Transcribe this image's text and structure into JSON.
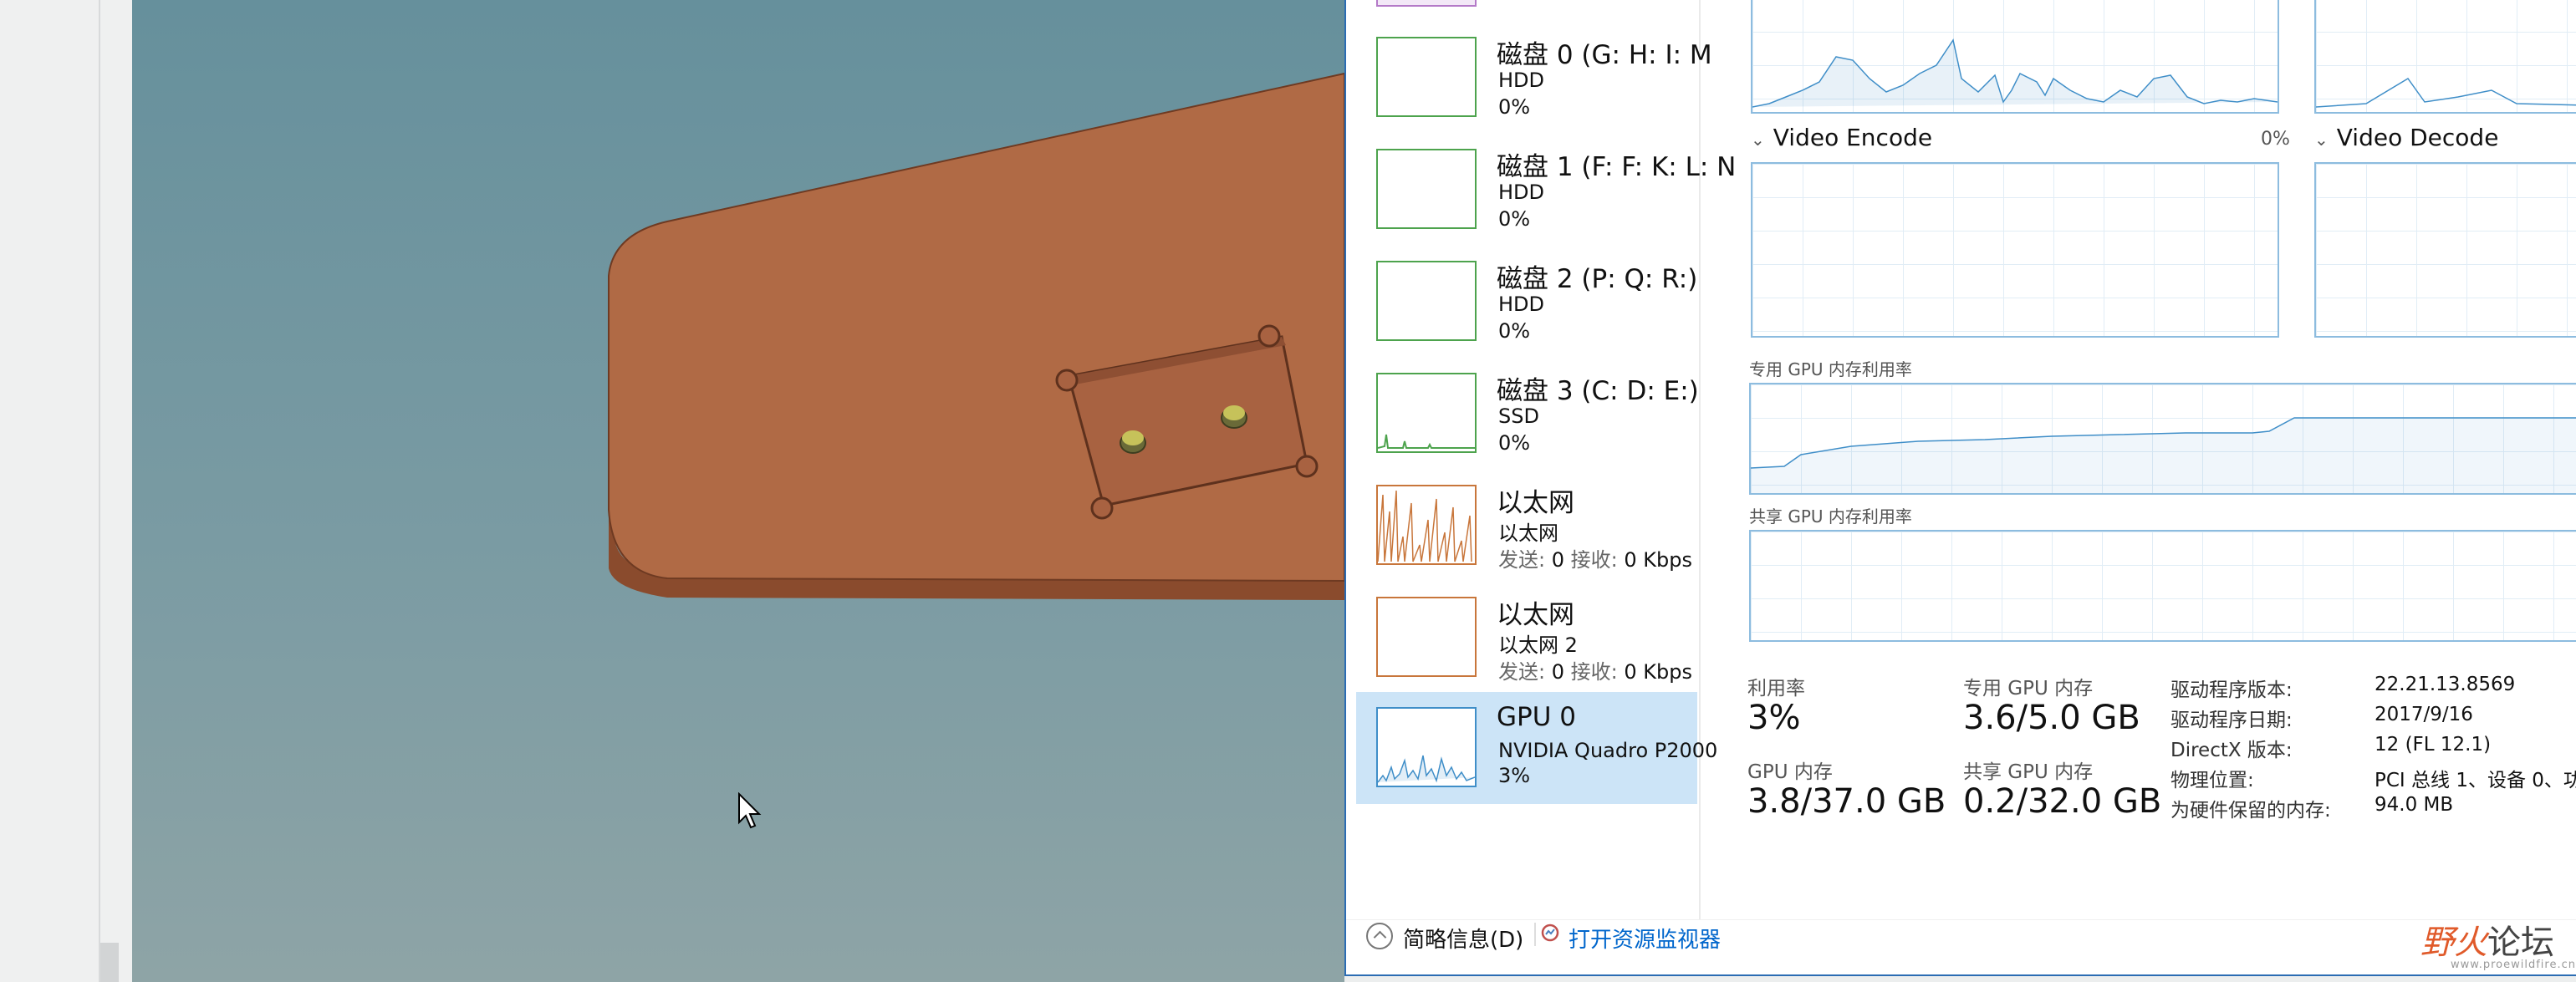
{
  "resources": [
    {
      "title": "磁盘 0 (G: H: I: M",
      "sub1": "HDD",
      "sub2": "0%",
      "color": "#4da34d"
    },
    {
      "title": "磁盘 1 (F: F: K: L: N",
      "sub1": "HDD",
      "sub2": "0%",
      "color": "#4da34d"
    },
    {
      "title": "磁盘 2 (P: Q: R:)",
      "sub1": "HDD",
      "sub2": "0%",
      "color": "#4da34d"
    },
    {
      "title": "磁盘 3 (C: D: E:)",
      "sub1": "SSD",
      "sub2": "0%",
      "color": "#4da34d"
    },
    {
      "title": "以太网",
      "sub1": "以太网",
      "send_label": "发送:",
      "send_value": "0",
      "recv_label": "接收:",
      "recv_value": "0 Kbps",
      "color": "#c8763b"
    },
    {
      "title": "以太网",
      "sub1": "以太网 2",
      "send_label": "发送:",
      "send_value": "0",
      "recv_label": "接收:",
      "recv_value": "0 Kbps",
      "color": "#c8763b"
    },
    {
      "title": "GPU 0",
      "sub1": "NVIDIA Quadro P2000",
      "sub2": "3%",
      "color": "#3f8ec8"
    }
  ],
  "gpu_panel": {
    "engines": [
      {
        "name": "Video Encode",
        "value": "0%"
      },
      {
        "name": "Video Decode"
      }
    ],
    "dedicated_mem_label": "专用 GPU 内存利用率",
    "shared_mem_label": "共享 GPU 内存利用率",
    "stats": {
      "utilization_label": "利用率",
      "utilization_value": "3%",
      "dedicated_label": "专用 GPU 内存",
      "dedicated_value": "3.6/5.0 GB",
      "gpu_mem_label": "GPU 内存",
      "gpu_mem_value": "3.8/37.0 GB",
      "shared_label": "共享 GPU 内存",
      "shared_value": "0.2/32.0 GB"
    },
    "info": [
      {
        "key": "驱动程序版本:",
        "value": "22.21.13.8569"
      },
      {
        "key": "驱动程序日期:",
        "value": "2017/9/16"
      },
      {
        "key": "DirectX 版本:",
        "value": "12 (FL 12.1)"
      },
      {
        "key": "物理位置:",
        "value": "PCI 总线 1、设备 0、功"
      },
      {
        "key": "为硬件保留的内存:",
        "value": "94.0 MB"
      }
    ]
  },
  "footer": {
    "collapse_label": "简略信息(D)",
    "resmon_link": "打开资源监视器"
  },
  "watermark": {
    "text_a": "野火",
    "text_b": "论坛",
    "url": "www.proewildfire.cn"
  },
  "colors": {
    "accent_blue": "#3f8ec8",
    "selection": "#cce4f7",
    "disk_green": "#4da34d",
    "ethernet_orange": "#c8763b",
    "part_copper": "#b06a45"
  }
}
